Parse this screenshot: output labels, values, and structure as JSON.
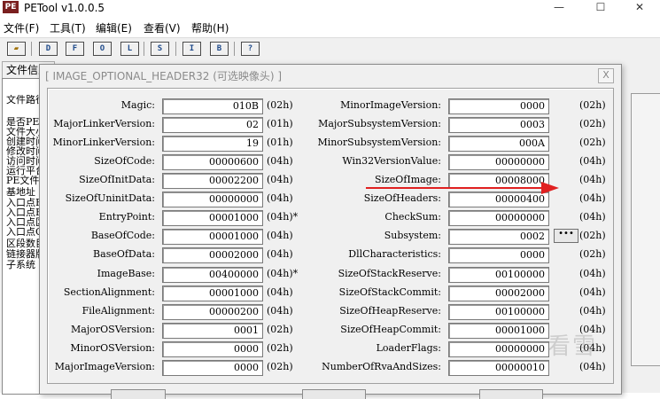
{
  "window": {
    "title": "PETool v1.0.0.5",
    "icon": "PE",
    "minimize": "—",
    "maximize": "☐",
    "close": "✕"
  },
  "menu": [
    "文件(F)",
    "工具(T)",
    "编辑(E)",
    "查看(V)",
    "帮助(H)"
  ],
  "toolbar": [
    "D",
    "F",
    "O",
    "L",
    "S",
    "I",
    "B",
    "?"
  ],
  "main": {
    "tab": "文件信息",
    "left_lines": [
      "文件路径",
      "是否PE文件",
      "文件大小",
      "创建时间",
      "修改时间",
      "访问时间",
      "运行平台",
      "PE文件头",
      "基地址",
      "入口点RVA",
      "入口点RAW",
      "入口点区段",
      "入口点OEP",
      "区段数目",
      "链接器版本",
      "子系统"
    ]
  },
  "dialog": {
    "title": "[ IMAGE_OPTIONAL_HEADER32 (可选映像头) ]",
    "close": "X",
    "left_fields": [
      {
        "label": "Magic:",
        "value": "010B",
        "size": "(02h)"
      },
      {
        "label": "MajorLinkerVersion:",
        "value": "02",
        "size": "(01h)"
      },
      {
        "label": "MinorLinkerVersion:",
        "value": "19",
        "size": "(01h)"
      },
      {
        "label": "SizeOfCode:",
        "value": "00000600",
        "size": "(04h)"
      },
      {
        "label": "SizeOfInitData:",
        "value": "00002200",
        "size": "(04h)"
      },
      {
        "label": "SizeOfUninitData:",
        "value": "00000000",
        "size": "(04h)"
      },
      {
        "label": "EntryPoint:",
        "value": "00001000",
        "size": "(04h)*"
      },
      {
        "label": "BaseOfCode:",
        "value": "00001000",
        "size": "(04h)"
      },
      {
        "label": "BaseOfData:",
        "value": "00002000",
        "size": "(04h)"
      },
      {
        "label": "ImageBase:",
        "value": "00400000",
        "size": "(04h)*"
      },
      {
        "label": "SectionAlignment:",
        "value": "00001000",
        "size": "(04h)"
      },
      {
        "label": "FileAlignment:",
        "value": "00000200",
        "size": "(04h)"
      },
      {
        "label": "MajorOSVersion:",
        "value": "0001",
        "size": "(02h)"
      },
      {
        "label": "MinorOSVersion:",
        "value": "0000",
        "size": "(02h)"
      },
      {
        "label": "MajorImageVersion:",
        "value": "0000",
        "size": "(02h)"
      }
    ],
    "right_fields": [
      {
        "label": "MinorImageVersion:",
        "value": "0000",
        "size": "(02h)"
      },
      {
        "label": "MajorSubsystemVersion:",
        "value": "0003",
        "size": "(02h)"
      },
      {
        "label": "MinorSubsystemVersion:",
        "value": "000A",
        "size": "(02h)"
      },
      {
        "label": "Win32VersionValue:",
        "value": "00000000",
        "size": "(04h)"
      },
      {
        "label": "SizeOfImage:",
        "value": "00008000",
        "size": "(04h)"
      },
      {
        "label": "SizeOfHeaders:",
        "value": "00000400",
        "size": "(04h)"
      },
      {
        "label": "CheckSum:",
        "value": "00000000",
        "size": "(04h)"
      },
      {
        "label": "Subsystem:",
        "value": "0002",
        "size": "(02h)"
      },
      {
        "label": "DllCharacteristics:",
        "value": "0000",
        "size": "(02h)"
      },
      {
        "label": "SizeOfStackReserve:",
        "value": "00100000",
        "size": "(04h)"
      },
      {
        "label": "SizeOfStackCommit:",
        "value": "00002000",
        "size": "(04h)"
      },
      {
        "label": "SizeOfHeapReserve:",
        "value": "00100000",
        "size": "(04h)"
      },
      {
        "label": "SizeOfHeapCommit:",
        "value": "00001000",
        "size": "(04h)"
      },
      {
        "label": "LoaderFlags:",
        "value": "00000000",
        "size": "(04h)"
      },
      {
        "label": "NumberOfRvaAndSizes:",
        "value": "00000010",
        "size": "(04h)"
      }
    ],
    "subsystem_button": "•••",
    "watermark": "看雪",
    "annotation_color": "#e02020"
  }
}
